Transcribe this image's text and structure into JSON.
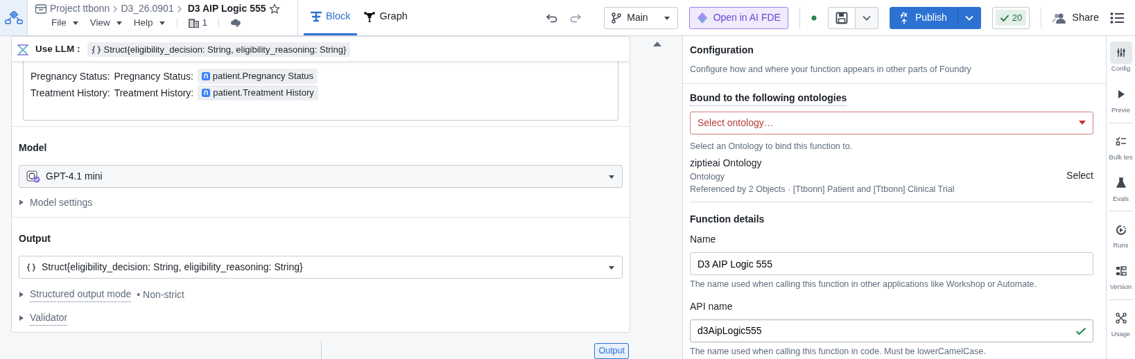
{
  "header": {
    "breadcrumbs": [
      "Project ttbonn",
      "D3_26.0901"
    ],
    "title": "D3 AIP Logic 555",
    "starred": false,
    "menus": [
      "File",
      "View",
      "Help"
    ],
    "count": "1"
  },
  "view_tabs": [
    {
      "label": "Block",
      "selected": true
    },
    {
      "label": "Graph",
      "selected": false
    }
  ],
  "toolbar": {
    "branch": "Main",
    "ai_button": "Open in AI FDE",
    "publish": "Publish",
    "checks": "20",
    "share": "Share"
  },
  "block": {
    "title": "Use LLM :",
    "type": "Struct{eligibility_decision: String, eligibility_reasoning: String}",
    "prompt_lines": [
      {
        "label": "Pregnancy Status:",
        "name": "Pregnancy Status:",
        "ref": "patient.Pregnancy Status"
      },
      {
        "label": "Treatment History:",
        "name": "Treatment History:",
        "ref": "patient.Treatment History"
      }
    ],
    "model": {
      "heading": "Model",
      "value": "GPT-4.1 mini",
      "settings": {
        "label": "Model settings",
        "expanded": false
      }
    },
    "output": {
      "heading": "Output",
      "value": "Struct{eligibility_decision: String, eligibility_reasoning: String}",
      "options": [
        {
          "label": "Structured output mode",
          "detail": "• Non-strict",
          "expanded": false
        },
        {
          "label": "Validator",
          "expanded": false
        }
      ]
    },
    "output_badge": "Output"
  },
  "config": {
    "title": "Configuration",
    "subtitle": "Configure how and where your function appears in other parts of Foundry",
    "ontology": {
      "heading": "Bound to the following ontologies",
      "placeholder": "Select ontology…",
      "invalid": true,
      "hint": "Select an Ontology to bind this function to.",
      "item": {
        "name": "ziptieai Ontology",
        "type": "Ontology",
        "refs": "Referenced by 2 Objects · [Ttbonn] Patient and [Ttbonn] Clinical Trial",
        "action": "Select"
      }
    },
    "details": {
      "heading": "Function details",
      "fields": [
        {
          "label": "Name",
          "value": "D3 AIP Logic 555",
          "valid": false,
          "hint": "The name used when calling this function in other applications like Workshop or Automate."
        },
        {
          "label": "API name",
          "value": "d3AipLogic555",
          "valid": true,
          "hint": "The name used when calling this function in code. Must be lowerCamelCase."
        }
      ]
    }
  },
  "rail": [
    {
      "label": "Config",
      "selected": true
    },
    {
      "label": "Previe",
      "selected": false
    },
    {
      "label": "Bulk tes",
      "selected": false
    },
    {
      "label": "Evals",
      "selected": false
    },
    {
      "label": "Runs",
      "selected": false
    },
    {
      "label": "Version",
      "selected": false
    },
    {
      "label": "Usage",
      "selected": false
    }
  ]
}
